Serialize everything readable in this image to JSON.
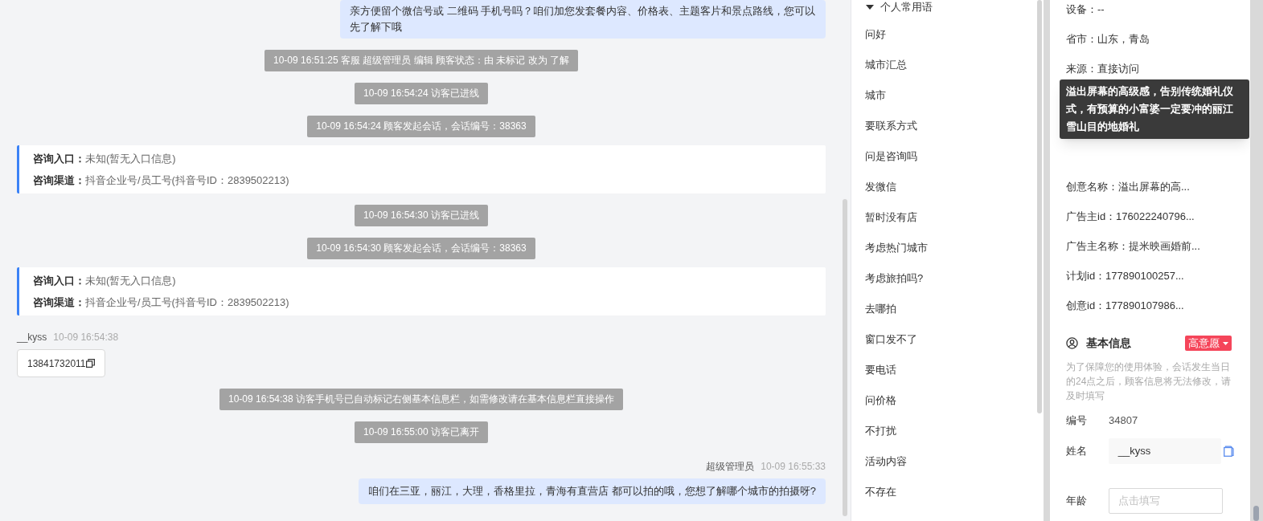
{
  "chat": {
    "messages": [
      {
        "kind": "agent_bubble",
        "text": "亲方便留个微信号或 二维码 手机号吗？咱们加您发套餐内容、价格表、主题客片和景点路线，您可以先了解下哦"
      },
      {
        "kind": "system",
        "text": "10-09 16:51:25 客服 超级管理员 编辑 顾客状态：由 未标记 改为 了解"
      },
      {
        "kind": "system",
        "text": "10-09 16:54:24 访客已进线"
      },
      {
        "kind": "system",
        "text": "10-09 16:54:24 顾客发起会话，会话编号：38363"
      },
      {
        "kind": "source",
        "entry_label": "咨询入口：",
        "entry_value": "未知(暂无入口信息)",
        "channel_label": "咨询渠道：",
        "channel_value": "抖音企业号/员工号(抖音号ID：2839502213)"
      },
      {
        "kind": "system",
        "text": "10-09 16:54:30 访客已进线"
      },
      {
        "kind": "system",
        "text": "10-09 16:54:30 顾客发起会话，会话编号：38363"
      },
      {
        "kind": "source",
        "entry_label": "咨询入口：",
        "entry_value": "未知(暂无入口信息)",
        "channel_label": "咨询渠道：",
        "channel_value": "抖音企业号/员工号(抖音号ID：2839502213)"
      },
      {
        "kind": "visitor",
        "sender": "__kyss",
        "time": "10-09 16:54:38",
        "text": "13841732011"
      },
      {
        "kind": "system",
        "text": "10-09 16:54:38 访客手机号已自动标记右侧基本信息栏，如需修改请在基本信息栏直接操作"
      },
      {
        "kind": "system",
        "text": "10-09 16:55:00 访客已离开"
      },
      {
        "kind": "agent",
        "sender": "超级管理员",
        "time": "10-09 16:55:33",
        "text": "咱们在三亚，丽江，大理，香格里拉，青海有直营店 都可以拍的哦，您想了解哪个城市的拍摄呀?"
      }
    ]
  },
  "phrases": {
    "group": "个人常用语",
    "expanded": true,
    "items": [
      "问好",
      "城市汇总",
      "城市",
      "要联系方式",
      "问是咨询吗",
      "发微信",
      "暂时没有店",
      "考虑热门城市",
      "考虑旅拍吗?",
      "去哪拍",
      "窗口发不了",
      "要电话",
      "问价格",
      "不打扰",
      "活动内容",
      "不存在"
    ]
  },
  "visitor_info": {
    "rows_top": [
      "设备：--",
      "省市：山东，青岛",
      "来源：直接访问"
    ],
    "tooltip": "溢出屏幕的高级感，告别传统婚礼仪式，有预算的小富婆一定要冲的丽江雪山目的地婚礼",
    "rows_bottom": [
      "创意名称：溢出屏幕的高...",
      "广告主id：176022240796...",
      "广告主名称：提米映画婚前...",
      "计划id：177890100257...",
      "创意id：177890107986..."
    ]
  },
  "basic_info": {
    "title": "基本信息",
    "intent": "高意愿",
    "notice": "为了保障您的使用体验，会话发生当日的24点之后，顾客信息将无法修改，请及时填写",
    "fields": [
      {
        "kind": "static",
        "label": "编号",
        "value": "34807"
      },
      {
        "kind": "readonly",
        "label": "姓名",
        "value": "__kyss"
      },
      {
        "kind": "input",
        "label": "年龄",
        "placeholder": "点击填写"
      }
    ]
  }
}
